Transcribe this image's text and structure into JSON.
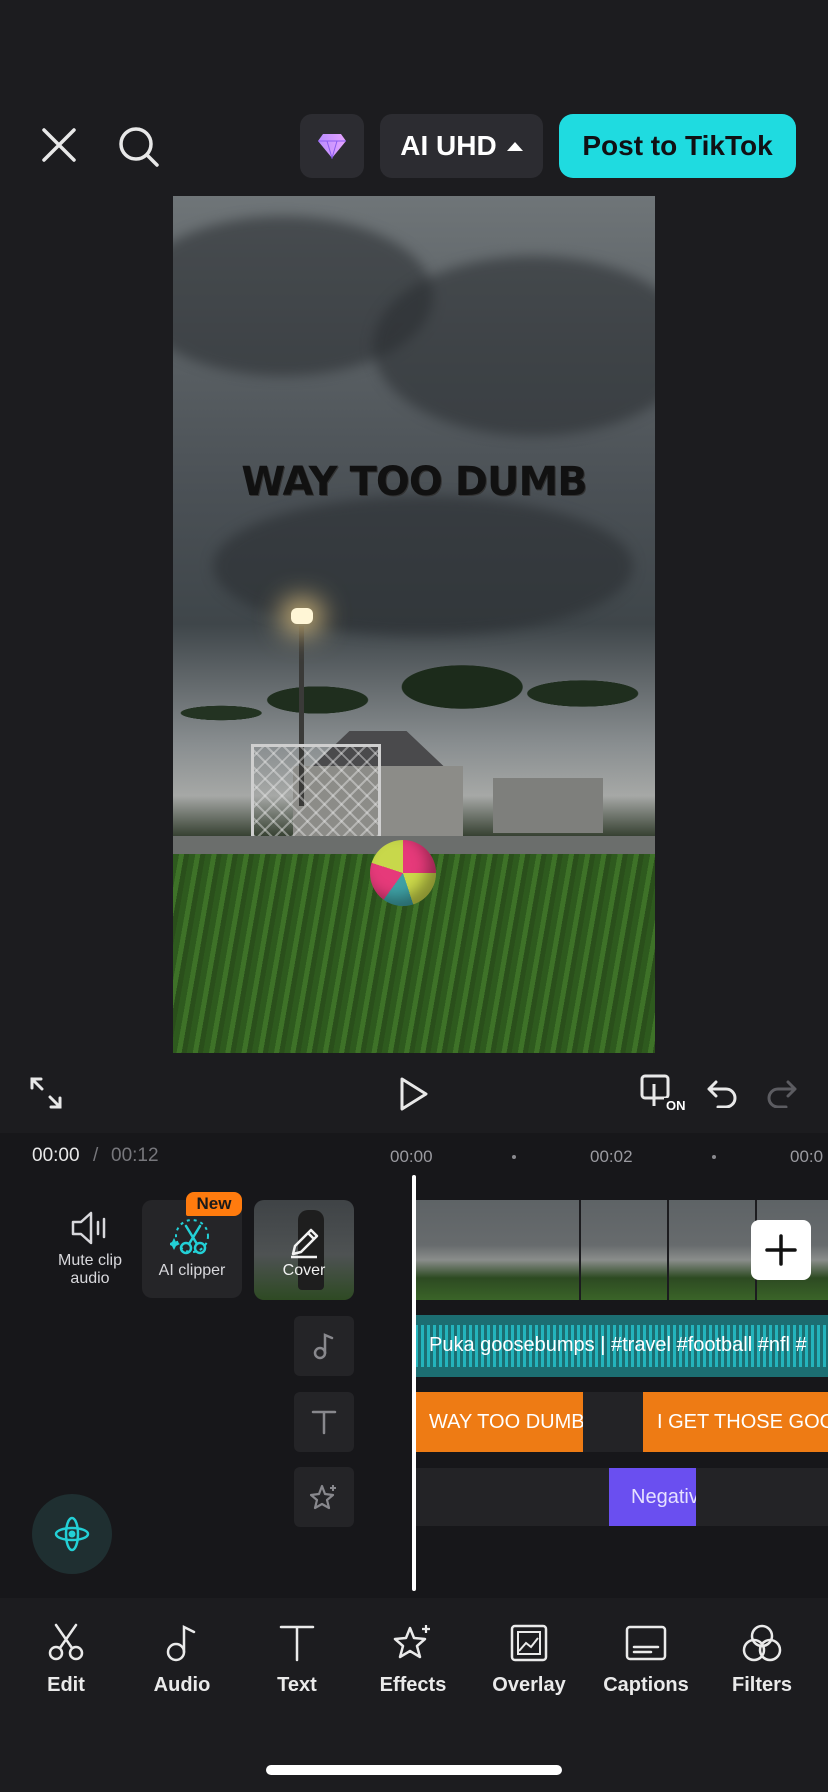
{
  "header": {
    "quality_label": "AI UHD",
    "post_label": "Post to TikTok"
  },
  "preview": {
    "overlay_text": "WAY TOO DUMB"
  },
  "playback": {
    "compare_badge": "ON"
  },
  "timeline": {
    "current_time": "00:00",
    "separator": "/",
    "total_time": "00:12",
    "ticks": [
      "00:00",
      "00:02",
      "00:0"
    ],
    "mute_label_line1": "Mute clip",
    "mute_label_line2": "audio",
    "ai_clipper_label": "AI clipper",
    "new_badge": "New",
    "cover_label": "Cover",
    "audio_clip_label": "Puka goosebumps | #travel #football #nfl #",
    "text_clips": [
      "WAY TOO DUMB",
      "I GET THOSE GOO"
    ],
    "effect_clip_label": "Negativ"
  },
  "toolbar": {
    "items": [
      {
        "label": "Edit",
        "icon": "scissors-icon"
      },
      {
        "label": "Audio",
        "icon": "music-note-icon"
      },
      {
        "label": "Text",
        "icon": "text-icon"
      },
      {
        "label": "Effects",
        "icon": "sparkle-star-icon"
      },
      {
        "label": "Overlay",
        "icon": "overlay-image-icon"
      },
      {
        "label": "Captions",
        "icon": "captions-icon"
      },
      {
        "label": "Filters",
        "icon": "filters-icon"
      }
    ]
  },
  "colors": {
    "accent": "#1fdbe0",
    "text_clip": "#ee7b14",
    "effect_clip": "#6a4ff0",
    "new_badge": "#ff7b0e"
  }
}
